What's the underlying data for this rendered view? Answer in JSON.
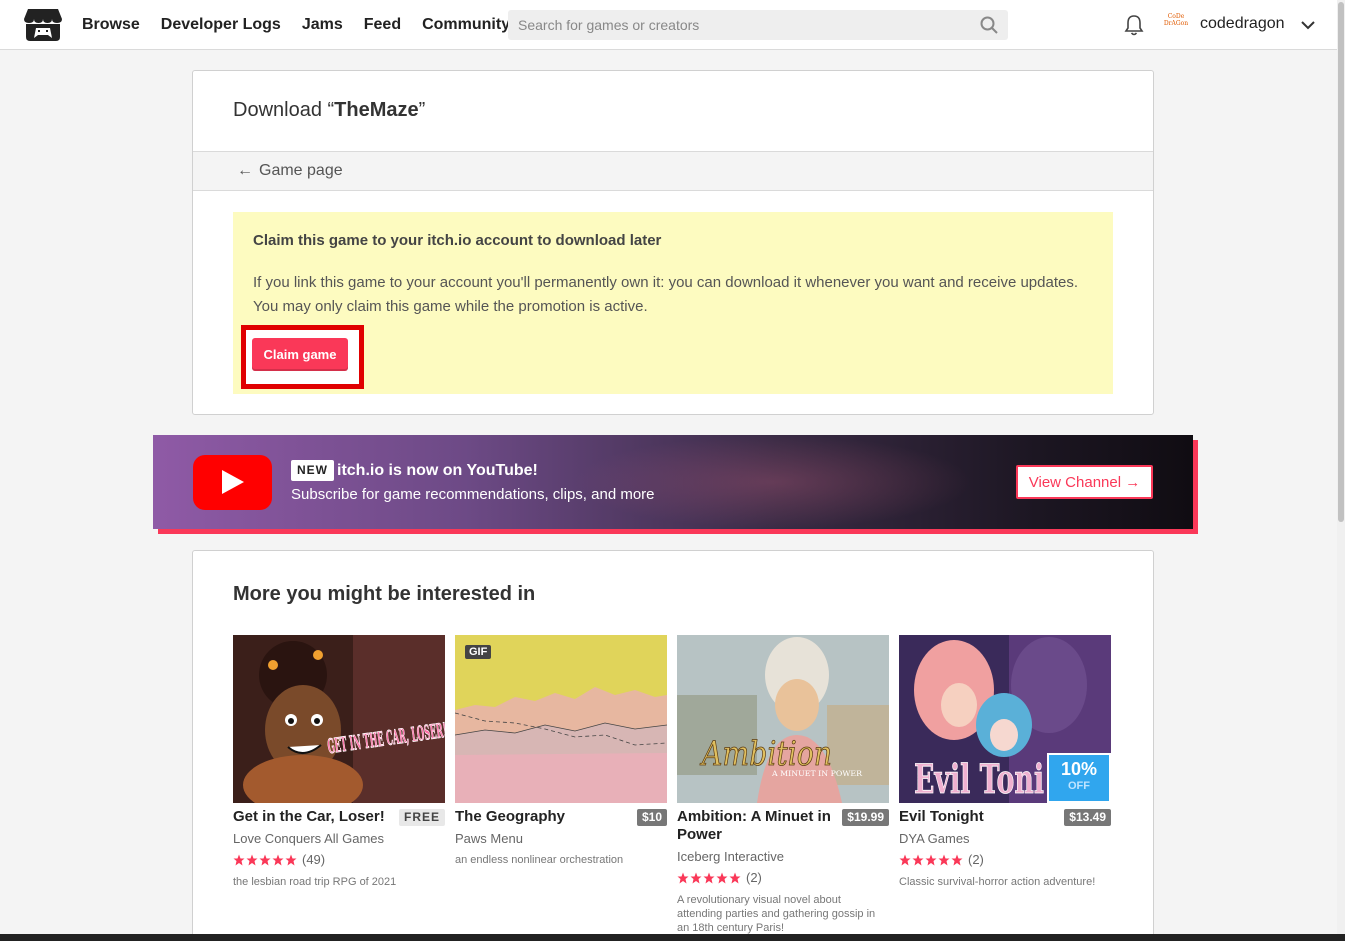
{
  "header": {
    "nav": [
      "Browse",
      "Developer Logs",
      "Jams",
      "Feed",
      "Community"
    ],
    "search_placeholder": "Search for games or creators",
    "avatar_text": "CoDe DrAGon",
    "username": "codedragon"
  },
  "download": {
    "title_prefix": "Download “",
    "game_name": "TheMaze",
    "title_suffix": "”",
    "back_link": "Game page",
    "claim_heading": "Claim this game to your itch.io account to download later",
    "claim_text": "If you link this game to your account you'll permanently own it: you can download it whenever you want and receive updates. You may only claim this game while the promotion is active.",
    "claim_button": "Claim game"
  },
  "youtube": {
    "badge": "NEW",
    "title": "itch.io is now on YouTube!",
    "subtitle": "Subscribe for game recommendations, clips, and more",
    "button": "View Channel →"
  },
  "recommendations": {
    "heading": "More you might be interested in",
    "games": [
      {
        "title": "Get in the Car, Loser!",
        "price": "FREE",
        "author": "Love Conquers All Games",
        "rating_count": "(49)",
        "description": "the lesbian road trip RPG of 2021",
        "cover_text": "GET IN THE CAR, LOSER!"
      },
      {
        "title": "The Geography",
        "price": "$10",
        "author": "Paws Menu",
        "description": "an endless nonlinear orchestration",
        "badge": "GIF"
      },
      {
        "title": "Ambition: A Minuet in Power",
        "price": "$19.99",
        "author": "Iceberg Interactive",
        "rating_count": "(2)",
        "description": "A revolutionary visual novel about attending parties and gathering gossip in an 18th century Paris!",
        "cover_text": "Ambition",
        "cover_subtext": "A MINUET IN POWER"
      },
      {
        "title": "Evil Tonight",
        "price": "$13.49",
        "author": "DYA Games",
        "rating_count": "(2)",
        "description": "Classic survival-horror action adventure!",
        "sale_pct": "10%",
        "sale_off": "OFF",
        "cover_text": "Evil Toni"
      }
    ]
  },
  "colors": {
    "accent": "#fa3858",
    "claim_bg": "#fdfbc0",
    "highlight_outline": "#e00000",
    "sale_blue": "#30a6ee"
  }
}
